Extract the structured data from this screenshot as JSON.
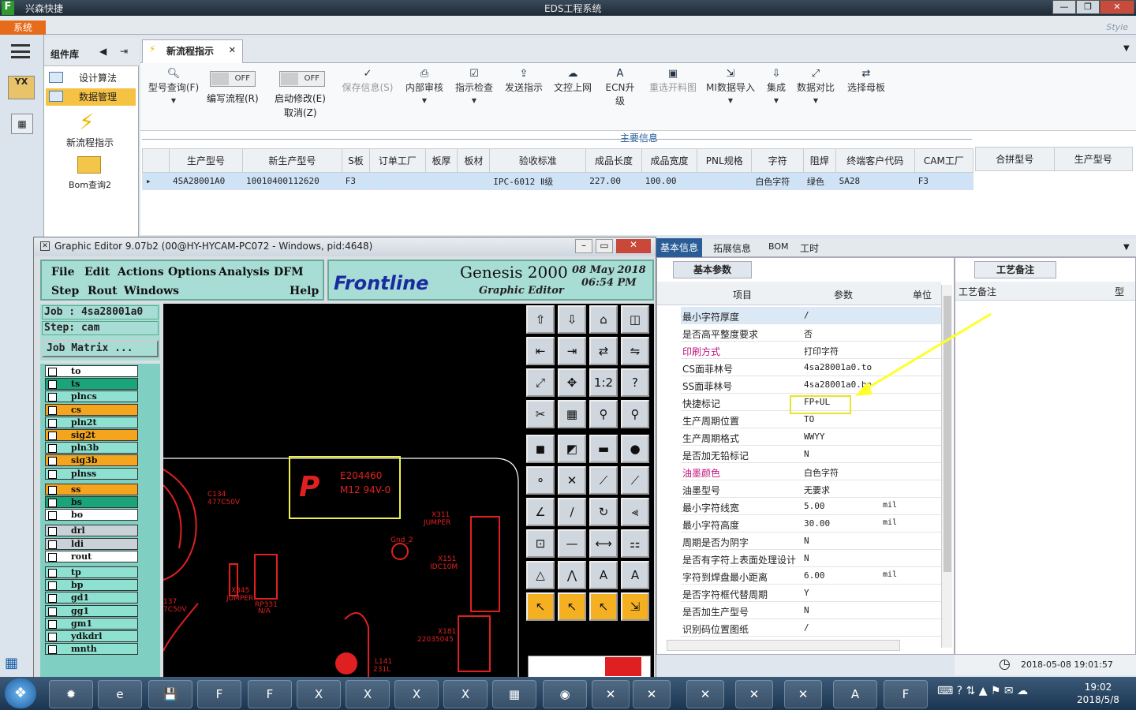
{
  "window": {
    "app_title": "兴森快捷",
    "center_title": "EDS工程系统",
    "system_tab": "系统",
    "style_label": "Style"
  },
  "sidebar": {
    "header": "组件库",
    "items": [
      {
        "label": "设计算法"
      },
      {
        "label": "数据管理"
      }
    ],
    "tools": [
      {
        "label": "新流程指示"
      },
      {
        "label": "Bom查询2"
      }
    ]
  },
  "tab": {
    "label": "新流程指示"
  },
  "toolbar": {
    "query": "型号查询(F)",
    "edit_flow": "编写流程(R)",
    "edit_flow_toggle": "OFF",
    "start_edit": "启动修改(E)",
    "start_edit_toggle": "OFF",
    "cancel": "取消(Z)",
    "save_info": "保存信息(S)",
    "internal_review": "内部审核",
    "instruction_check": "指示检查",
    "send_instruction": "发送指示",
    "upload": "文控上网",
    "ecn": "ECN升级",
    "reselect": "重选开料图",
    "mi_import": "MI数据导入",
    "integrate": "集成",
    "compare": "数据对比",
    "select_mother": "选择母板"
  },
  "main": {
    "section_title": "主要信息",
    "columns": [
      "生产型号",
      "新生产型号",
      "S板",
      "订单工厂",
      "板厚",
      "板材",
      "验收标准",
      "成品长度",
      "成品宽度",
      "PNL规格",
      "字符",
      "阻焊",
      "终端客户代码",
      "CAM工厂"
    ],
    "rows": [
      [
        "4SA28001A0",
        "10010400112620",
        "F3",
        "",
        "",
        "",
        "IPC-6012 Ⅱ级",
        "227.00",
        "100.00",
        "",
        "白色字符",
        "绿色",
        "SA28",
        "F3"
      ]
    ],
    "side_columns": [
      "合拼型号",
      "生产型号"
    ]
  },
  "lower": {
    "tabs": [
      "基本信息",
      "拓展信息",
      "BOM",
      "工时"
    ],
    "subtab": "基本参数",
    "columns": [
      "项目",
      "参数",
      "单位"
    ],
    "params": [
      {
        "k": "最小字符厚度",
        "v": "/",
        "u": ""
      },
      {
        "k": "是否高平整度要求",
        "v": "否",
        "u": ""
      },
      {
        "k": "印刷方式",
        "v": "打印字符",
        "u": ""
      },
      {
        "k": "CS面菲林号",
        "v": "4sa28001a0.to",
        "u": ""
      },
      {
        "k": "SS面菲林号",
        "v": "4sa28001a0.bo",
        "u": ""
      },
      {
        "k": "快捷标记",
        "v": "FP+UL",
        "u": ""
      },
      {
        "k": "生产周期位置",
        "v": "TO",
        "u": ""
      },
      {
        "k": "生产周期格式",
        "v": "WWYY",
        "u": ""
      },
      {
        "k": "是否加无铅标记",
        "v": "N",
        "u": ""
      },
      {
        "k": "油墨颜色",
        "v": "白色字符",
        "u": ""
      },
      {
        "k": "油墨型号",
        "v": "无要求",
        "u": ""
      },
      {
        "k": "最小字符线宽",
        "v": "5.00",
        "u": "mil"
      },
      {
        "k": "最小字符高度",
        "v": "30.00",
        "u": "mil"
      },
      {
        "k": "周期是否为阴字",
        "v": "N",
        "u": ""
      },
      {
        "k": "是否有字符上表面处理设计",
        "v": "N",
        "u": ""
      },
      {
        "k": "字符到焊盘最小距离",
        "v": "6.00",
        "u": "mil"
      },
      {
        "k": "是否字符框代替周期",
        "v": "Y",
        "u": ""
      },
      {
        "k": "是否加生产型号",
        "v": "N",
        "u": ""
      },
      {
        "k": "识别码位置图纸",
        "v": "/",
        "u": ""
      }
    ],
    "notes_tab": "工艺备注",
    "notes_header": "工艺备注",
    "notes_col2": "型",
    "datetime": "2018-05-08 19:01:57"
  },
  "graphic_editor": {
    "title": "Graphic Editor 9.07b2 (00@HY-HYCAM-PC072 - Windows, pid:4648)",
    "menu": [
      "File",
      "Edit",
      "Actions",
      "Options",
      "Analysis",
      "DFM",
      "Step",
      "Rout",
      "Windows",
      "Help"
    ],
    "brand": "Frontline",
    "product": "Genesis 2000",
    "subtitle": "Graphic Editor",
    "date": "08 May 2018",
    "time": "06:54 PM",
    "job": "Job : 4sa28001a0",
    "step": "Step: cam",
    "job_matrix": "Job Matrix ...",
    "layers": [
      "to",
      "ts",
      "plncs",
      "cs",
      "pln2t",
      "sig2t",
      "pln3b",
      "sig3b",
      "plnss",
      "ss",
      "bs",
      "bo",
      "drl",
      "ldi",
      "rout",
      "tp",
      "bp",
      "gd1",
      "gg1",
      "gm1",
      "ydkdrl",
      "mnth"
    ],
    "canvas_labels": {
      "ul1": "E204460",
      "ul2": "M12 94V-0",
      "c134": "C134",
      "c134v": "477C50V",
      "x311": "X311",
      "jumper": "JUMPER",
      "gnd": "Gnd_2",
      "x151": "X151",
      "idc": "IDC10M",
      "x345": "X345",
      "jumper2": "JUMPER",
      "rp": "RP331",
      "na": "N/A",
      "x181": "X181",
      "x181v": "22035045",
      "l141": "L141",
      "l141v": "231L",
      "c137": "137",
      "c137v": "7C50V"
    }
  },
  "taskbar": {
    "time": "19:02",
    "date": "2018/5/8"
  }
}
